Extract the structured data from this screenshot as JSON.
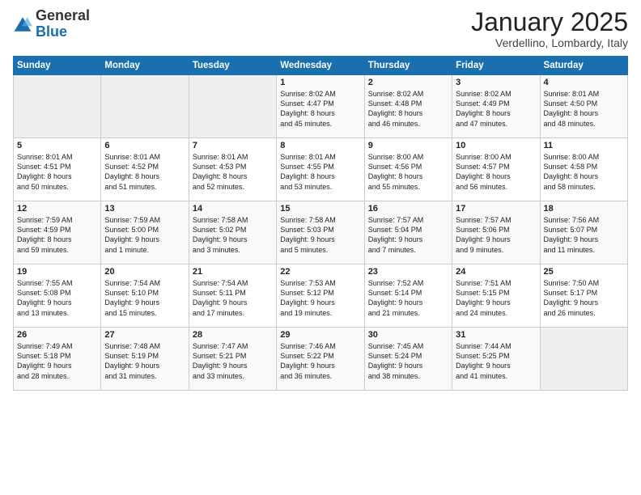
{
  "header": {
    "logo": {
      "general": "General",
      "blue": "Blue"
    },
    "title": "January 2025",
    "location": "Verdellino, Lombardy, Italy"
  },
  "weekdays": [
    "Sunday",
    "Monday",
    "Tuesday",
    "Wednesday",
    "Thursday",
    "Friday",
    "Saturday"
  ],
  "weeks": [
    [
      {
        "day": "",
        "info": ""
      },
      {
        "day": "",
        "info": ""
      },
      {
        "day": "",
        "info": ""
      },
      {
        "day": "1",
        "info": "Sunrise: 8:02 AM\nSunset: 4:47 PM\nDaylight: 8 hours\nand 45 minutes."
      },
      {
        "day": "2",
        "info": "Sunrise: 8:02 AM\nSunset: 4:48 PM\nDaylight: 8 hours\nand 46 minutes."
      },
      {
        "day": "3",
        "info": "Sunrise: 8:02 AM\nSunset: 4:49 PM\nDaylight: 8 hours\nand 47 minutes."
      },
      {
        "day": "4",
        "info": "Sunrise: 8:01 AM\nSunset: 4:50 PM\nDaylight: 8 hours\nand 48 minutes."
      }
    ],
    [
      {
        "day": "5",
        "info": "Sunrise: 8:01 AM\nSunset: 4:51 PM\nDaylight: 8 hours\nand 50 minutes."
      },
      {
        "day": "6",
        "info": "Sunrise: 8:01 AM\nSunset: 4:52 PM\nDaylight: 8 hours\nand 51 minutes."
      },
      {
        "day": "7",
        "info": "Sunrise: 8:01 AM\nSunset: 4:53 PM\nDaylight: 8 hours\nand 52 minutes."
      },
      {
        "day": "8",
        "info": "Sunrise: 8:01 AM\nSunset: 4:55 PM\nDaylight: 8 hours\nand 53 minutes."
      },
      {
        "day": "9",
        "info": "Sunrise: 8:00 AM\nSunset: 4:56 PM\nDaylight: 8 hours\nand 55 minutes."
      },
      {
        "day": "10",
        "info": "Sunrise: 8:00 AM\nSunset: 4:57 PM\nDaylight: 8 hours\nand 56 minutes."
      },
      {
        "day": "11",
        "info": "Sunrise: 8:00 AM\nSunset: 4:58 PM\nDaylight: 8 hours\nand 58 minutes."
      }
    ],
    [
      {
        "day": "12",
        "info": "Sunrise: 7:59 AM\nSunset: 4:59 PM\nDaylight: 8 hours\nand 59 minutes."
      },
      {
        "day": "13",
        "info": "Sunrise: 7:59 AM\nSunset: 5:00 PM\nDaylight: 9 hours\nand 1 minute."
      },
      {
        "day": "14",
        "info": "Sunrise: 7:58 AM\nSunset: 5:02 PM\nDaylight: 9 hours\nand 3 minutes."
      },
      {
        "day": "15",
        "info": "Sunrise: 7:58 AM\nSunset: 5:03 PM\nDaylight: 9 hours\nand 5 minutes."
      },
      {
        "day": "16",
        "info": "Sunrise: 7:57 AM\nSunset: 5:04 PM\nDaylight: 9 hours\nand 7 minutes."
      },
      {
        "day": "17",
        "info": "Sunrise: 7:57 AM\nSunset: 5:06 PM\nDaylight: 9 hours\nand 9 minutes."
      },
      {
        "day": "18",
        "info": "Sunrise: 7:56 AM\nSunset: 5:07 PM\nDaylight: 9 hours\nand 11 minutes."
      }
    ],
    [
      {
        "day": "19",
        "info": "Sunrise: 7:55 AM\nSunset: 5:08 PM\nDaylight: 9 hours\nand 13 minutes."
      },
      {
        "day": "20",
        "info": "Sunrise: 7:54 AM\nSunset: 5:10 PM\nDaylight: 9 hours\nand 15 minutes."
      },
      {
        "day": "21",
        "info": "Sunrise: 7:54 AM\nSunset: 5:11 PM\nDaylight: 9 hours\nand 17 minutes."
      },
      {
        "day": "22",
        "info": "Sunrise: 7:53 AM\nSunset: 5:12 PM\nDaylight: 9 hours\nand 19 minutes."
      },
      {
        "day": "23",
        "info": "Sunrise: 7:52 AM\nSunset: 5:14 PM\nDaylight: 9 hours\nand 21 minutes."
      },
      {
        "day": "24",
        "info": "Sunrise: 7:51 AM\nSunset: 5:15 PM\nDaylight: 9 hours\nand 24 minutes."
      },
      {
        "day": "25",
        "info": "Sunrise: 7:50 AM\nSunset: 5:17 PM\nDaylight: 9 hours\nand 26 minutes."
      }
    ],
    [
      {
        "day": "26",
        "info": "Sunrise: 7:49 AM\nSunset: 5:18 PM\nDaylight: 9 hours\nand 28 minutes."
      },
      {
        "day": "27",
        "info": "Sunrise: 7:48 AM\nSunset: 5:19 PM\nDaylight: 9 hours\nand 31 minutes."
      },
      {
        "day": "28",
        "info": "Sunrise: 7:47 AM\nSunset: 5:21 PM\nDaylight: 9 hours\nand 33 minutes."
      },
      {
        "day": "29",
        "info": "Sunrise: 7:46 AM\nSunset: 5:22 PM\nDaylight: 9 hours\nand 36 minutes."
      },
      {
        "day": "30",
        "info": "Sunrise: 7:45 AM\nSunset: 5:24 PM\nDaylight: 9 hours\nand 38 minutes."
      },
      {
        "day": "31",
        "info": "Sunrise: 7:44 AM\nSunset: 5:25 PM\nDaylight: 9 hours\nand 41 minutes."
      },
      {
        "day": "",
        "info": ""
      }
    ]
  ]
}
